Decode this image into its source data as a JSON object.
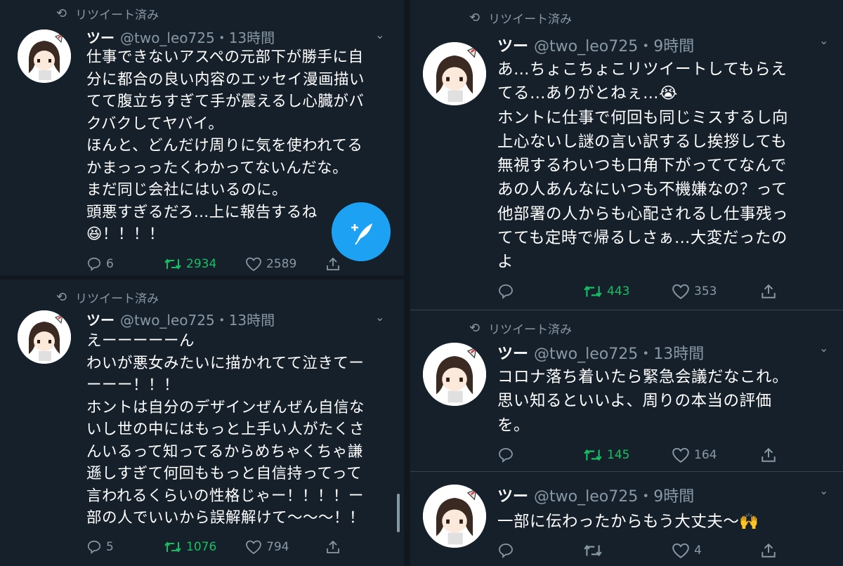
{
  "retweeted_label": "リツイート済み",
  "accent_color": "#1da1f2",
  "retweet_active_color": "#17bf63",
  "compose_icon": "feather-plus-icon",
  "tweets": [
    {
      "name": "ツー",
      "handle_time": "@two_leo725・13時間",
      "retweeted": true,
      "text": "仕事できないアスペの元部下が勝手に自\n分に都合の良い内容のエッセイ漫画描い\nてて腹立ちすぎて手が震えるし心臓がバ\nクバクしてヤバイ。\nほんと、どんだけ周りに気を使われてる\nかまっっったくわかってないんだな。\nまだ同じ会社にはいるのに。\n頭悪すぎるだろ…上に報告するね\n😆！！！！",
      "replies": "6",
      "retweets": "2934",
      "likes": "2589"
    },
    {
      "name": "ツー",
      "handle_time": "@two_leo725・13時間",
      "retweeted": true,
      "text": "えーーーーーん\nわいが悪女みたいに描かれてて泣きてー\nーーー！！！\nホントは自分のデザインぜんぜん自信な\nいし世の中にはもっと上手い人がたくさ\nんいるって知ってるからめちゃくちゃ謙\n遜しすぎて何回ももっと自信持ってって\n言われるくらいの性格じゃー！！！！ー\n部の人でいいから誤解解けて〜〜〜！！",
      "replies": "5",
      "retweets": "1076",
      "likes": "794"
    },
    {
      "name": "ツー",
      "handle_time": "@two_leo725・9時間",
      "retweeted": true,
      "text": "あ…ちょこちょこリツイートしてもらえ\nてる…ありがとねぇ…😭\nホントに仕事で何回も同じミスするし向\n上心ないし謎の言い訳するし挨拶しても\n無視するわいつも口角下がっててなんで\nあの人あんなにいつも不機嫌なの？って\n他部署の人からも心配されるし仕事残っ\nてても定時で帰るしさぁ…大変だったの\nよ",
      "replies": "",
      "retweets": "443",
      "likes": "353"
    },
    {
      "name": "ツー",
      "handle_time": "@two_leo725・13時間",
      "retweeted": true,
      "text": "コロナ落ち着いたら緊急会議だなこれ。\n思い知るといいよ、周りの本当の評価\nを。",
      "replies": "",
      "retweets": "145",
      "likes": "164"
    },
    {
      "name": "ツー",
      "handle_time": "@two_leo725・9時間",
      "retweeted": false,
      "text": "一部に伝わったからもう大丈夫〜🙌",
      "replies": "",
      "retweets": "",
      "likes": "4"
    }
  ]
}
